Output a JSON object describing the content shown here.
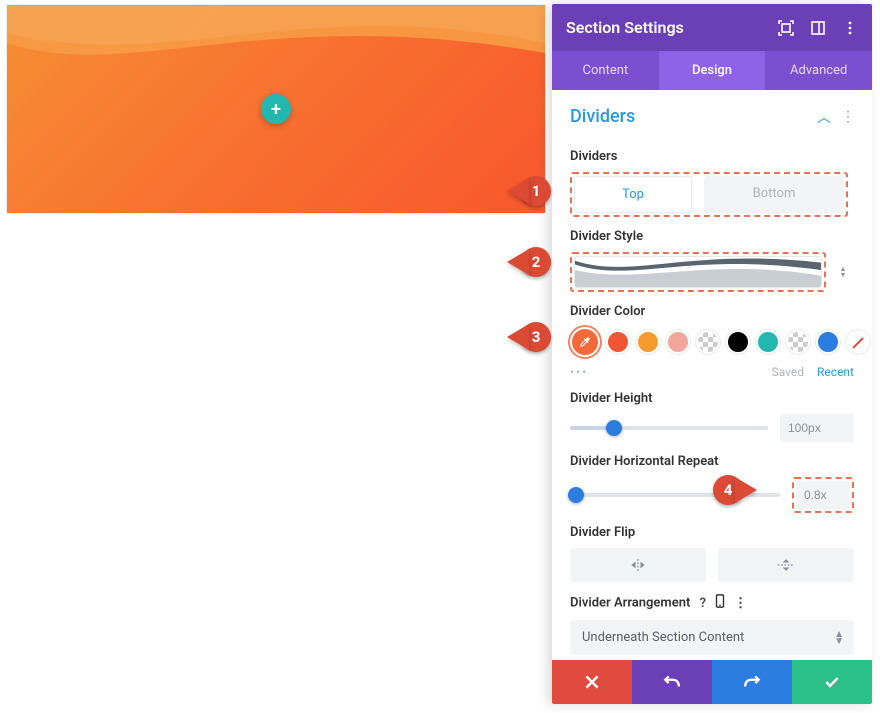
{
  "header": {
    "title": "Section Settings"
  },
  "tabs": [
    {
      "label": "Content"
    },
    {
      "label": "Design"
    },
    {
      "label": "Advanced"
    }
  ],
  "section": {
    "title": "Dividers"
  },
  "groups": {
    "dividers_label": "Dividers",
    "divider_style_label": "Divider Style",
    "divider_color_label": "Divider Color",
    "divider_height_label": "Divider Height",
    "divider_repeat_label": "Divider Horizontal Repeat",
    "divider_flip_label": "Divider Flip",
    "divider_arrangement_label": "Divider Arrangement"
  },
  "position_toggle": {
    "top": "Top",
    "bottom": "Bottom"
  },
  "colors": {
    "picker": "#f26a3c",
    "presets": [
      "#f05636",
      "#f79b2e",
      "#f3a69a",
      "transparent",
      "#000000",
      "#22b8af",
      "transparent",
      "#2b7de0",
      "none"
    ]
  },
  "swatch_meta": {
    "saved": "Saved",
    "recent": "Recent"
  },
  "height": {
    "value": "100px",
    "pct": 22
  },
  "repeat": {
    "value": "0.8x",
    "pct": 3
  },
  "arrangement": {
    "selected": "Underneath Section Content"
  },
  "callouts": {
    "one": "1",
    "two": "2",
    "three": "3",
    "four": "4"
  }
}
